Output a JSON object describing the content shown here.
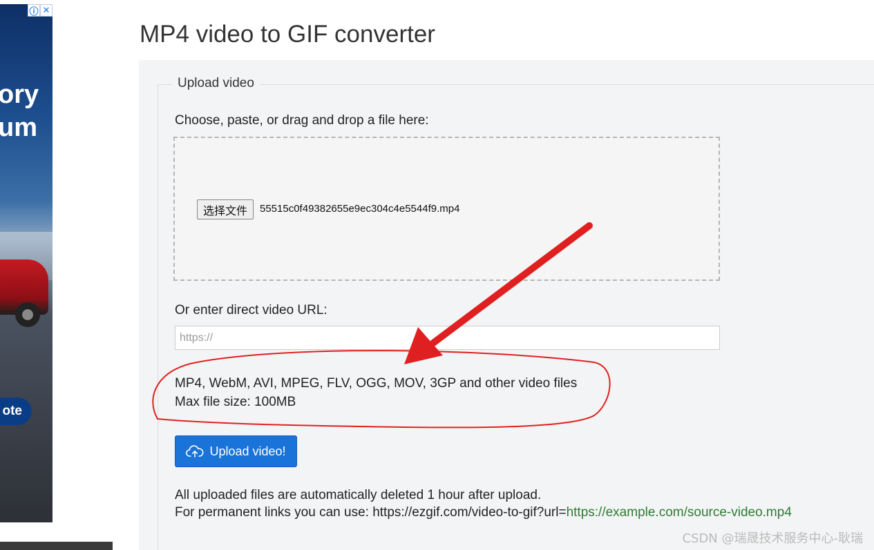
{
  "ad": {
    "line1": "ory",
    "line2": "um",
    "cta": "ote"
  },
  "page": {
    "title": "MP4 video to GIF converter"
  },
  "upload": {
    "legend": "Upload video",
    "choose_label": "Choose, paste, or drag and drop a file here:",
    "file_button": "选择文件",
    "file_name": "55515c0f49382655e9ec304c4e5544f9.mp4",
    "url_label": "Or enter direct video URL:",
    "url_placeholder": "https://",
    "formats": "MP4, WebM, AVI, MPEG, FLV, OGG, MOV, 3GP and other video files",
    "max_size": "Max file size: 100MB",
    "submit_label": "Upload video!",
    "note_line1": "All uploaded files are automatically deleted 1 hour after upload.",
    "note_line2_prefix": "For permanent links you can use: https://ezgif.com/video-to-gif?url=",
    "note_line2_link": "https://example.com/source-video.mp4"
  },
  "watermark": "CSDN @瑞晟技术服务中心-耿瑞",
  "colors": {
    "primary_button": "#1a73d8",
    "link_green": "#2e7d32",
    "annotation_red": "#e02020"
  }
}
